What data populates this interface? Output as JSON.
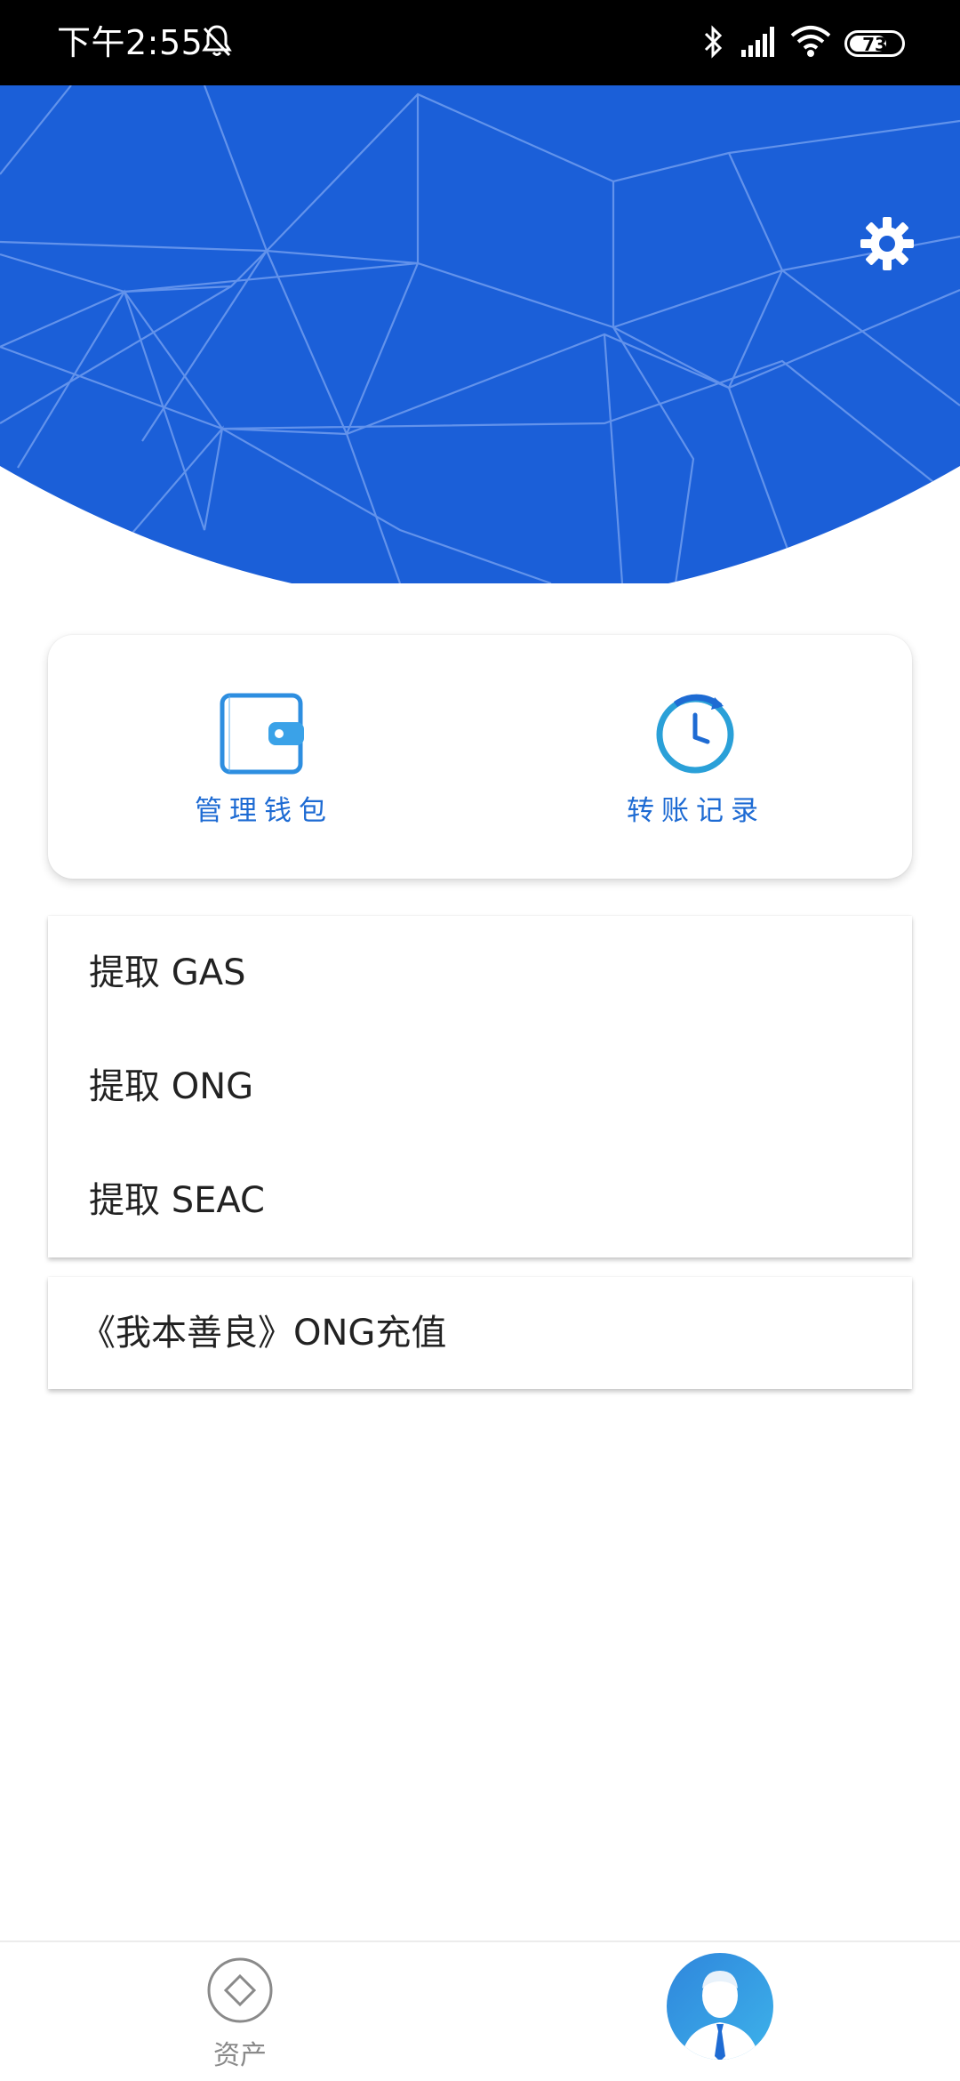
{
  "status_bar": {
    "time": "下午2:55",
    "battery": "73",
    "battery_level": 0.73,
    "icons": [
      "bell-muted-icon",
      "bluetooth-icon",
      "signal-icon",
      "wifi-icon",
      "battery-icon"
    ]
  },
  "header": {
    "colors": {
      "background": "#1b5fd8",
      "lines": "#6f9cf0"
    },
    "settings_icon": "gear-icon"
  },
  "quick_actions": [
    {
      "label": "管理钱包",
      "icon": "wallet-icon"
    },
    {
      "label": "转账记录",
      "icon": "clock-history-icon"
    }
  ],
  "menu": {
    "items": [
      {
        "label": "提取 GAS"
      },
      {
        "label": "提取 ONG"
      },
      {
        "label": "提取 SEAC"
      }
    ]
  },
  "recharge": {
    "label": "《我本善良》ONG充值"
  },
  "bottom_nav": {
    "assets_label": "资产",
    "assets_icon": "diamond-icon",
    "profile_icon": "user-avatar-icon"
  },
  "accent_color": "#1e6bd3"
}
